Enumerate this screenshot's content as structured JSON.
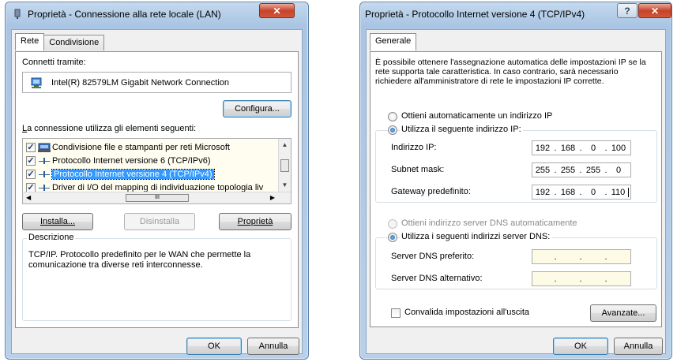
{
  "left_window": {
    "title": "Proprietà - Connessione alla rete locale (LAN)",
    "tabs": [
      "Rete",
      "Condivisione"
    ],
    "connect_using_label": "Connetti tramite:",
    "adapter_name": "Intel(R) 82579LM Gigabit Network Connection",
    "configure_button": "Configura...",
    "items_label_prefix": "L",
    "items_label_rest": "a connessione utilizza gli elementi seguenti:",
    "items": [
      {
        "label": "Condivisione file e stampanti per reti Microsoft",
        "checked": true
      },
      {
        "label": "Protocollo Internet versione 6 (TCP/IPv6)",
        "checked": true
      },
      {
        "label": "Protocollo Internet versione 4 (TCP/IPv4)",
        "checked": true,
        "selected": true
      },
      {
        "label": "Driver di I/O del mapping di individuazione topologia liv",
        "checked": true
      }
    ],
    "hscroll_thumb_glyph": "III",
    "install_button": "Installa...",
    "uninstall_button": "Disinstalla",
    "properties_button": "Proprietà",
    "description_title": "Descrizione",
    "description_text": "TCP/IP. Protocollo predefinito per le WAN che permette la comunicazione tra diverse reti interconnesse.",
    "ok_button": "OK",
    "cancel_button": "Annulla"
  },
  "right_window": {
    "title": "Proprietà - Protocollo Internet versione 4 (TCP/IPv4)",
    "tab": "Generale",
    "intro_text": "È possibile ottenere l'assegnazione automatica delle impostazioni IP se la rete supporta tale caratteristica. In caso contrario, sarà necessario richiedere all'amministratore di rete le impostazioni IP corrette.",
    "auto_ip_label": "Ottieni automaticamente un indirizzo IP",
    "manual_ip_label": "Utilizza il seguente indirizzo IP:",
    "ip_address_label": "Indirizzo IP:",
    "ip_address": [
      "192",
      "168",
      "0",
      "100"
    ],
    "subnet_label": "Subnet mask:",
    "subnet_mask": [
      "255",
      "255",
      "255",
      "0"
    ],
    "gateway_label": "Gateway predefinito:",
    "gateway": [
      "192",
      "168",
      "0",
      "110"
    ],
    "auto_dns_label": "Ottieni indirizzo server DNS automaticamente",
    "manual_dns_label": "Utilizza i seguenti indirizzi server DNS:",
    "preferred_dns_label": "Server DNS preferito:",
    "alternate_dns_label": "Server DNS alternativo:",
    "validate_label": "Convalida impostazioni all'uscita",
    "advanced_button": "Avanzate...",
    "ok_button": "OK",
    "cancel_button": "Annulla"
  },
  "colors": {
    "selection": "#3399ff",
    "titlebar": "#b8d0ea",
    "close_button": "#c7432a"
  }
}
